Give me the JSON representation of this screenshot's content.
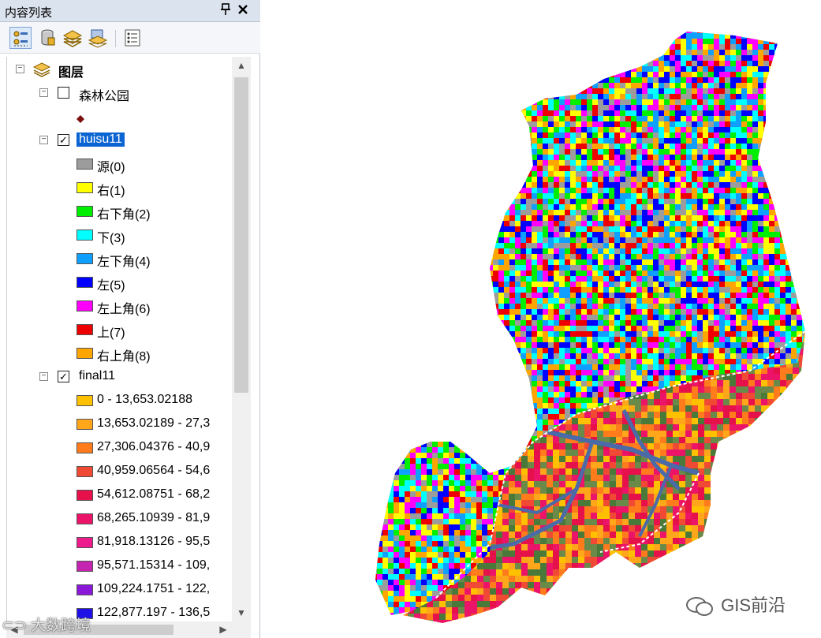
{
  "toc": {
    "title": "内容列表",
    "pin_icon": "pin-icon",
    "close_icon": "close-icon",
    "toolbar": {
      "buttons": [
        "list-by-drawing-order",
        "list-by-source",
        "list-by-visibility",
        "list-by-selection",
        "options"
      ]
    },
    "root_label": "图层",
    "layers": [
      {
        "name": "森林公园",
        "checked": false,
        "point_symbol_color": "#7a1010"
      },
      {
        "name": "huisu11",
        "checked": true,
        "selected": true,
        "legend": [
          {
            "label": "源(0)",
            "color": "#9c9c9c"
          },
          {
            "label": "右(1)",
            "color": "#ffff00"
          },
          {
            "label": "右下角(2)",
            "color": "#00ee00"
          },
          {
            "label": "下(3)",
            "color": "#00ffff"
          },
          {
            "label": "左下角(4)",
            "color": "#0fa0ff"
          },
          {
            "label": "左(5)",
            "color": "#0000ff"
          },
          {
            "label": "左上角(6)",
            "color": "#ff00ff"
          },
          {
            "label": "上(7)",
            "color": "#ee0000"
          },
          {
            "label": "右上角(8)",
            "color": "#ffa500"
          }
        ]
      },
      {
        "name": "final11",
        "checked": true,
        "legend": [
          {
            "label": "0 - 13,653.02188",
            "color": "#ffc000"
          },
          {
            "label": "13,653.02189 - 27,3",
            "color": "#ffa61a"
          },
          {
            "label": "27,306.04376 - 40,9",
            "color": "#ff7b1c"
          },
          {
            "label": "40,959.06564 - 54,6",
            "color": "#f04a35"
          },
          {
            "label": "54,612.08751 - 68,2",
            "color": "#e6104a"
          },
          {
            "label": "68,265.10939 - 81,9",
            "color": "#ec1468"
          },
          {
            "label": "81,918.13126 - 95,5",
            "color": "#ee1b8c"
          },
          {
            "label": "95,571.15314 - 109,",
            "color": "#c424b0"
          },
          {
            "label": "109,224.1751 - 122,",
            "color": "#8a18d8"
          },
          {
            "label": "122,877.197 - 136,5",
            "color": "#2010e8"
          }
        ]
      }
    ]
  },
  "watermarks": {
    "left": "大数跨境",
    "right": "GIS前沿"
  }
}
